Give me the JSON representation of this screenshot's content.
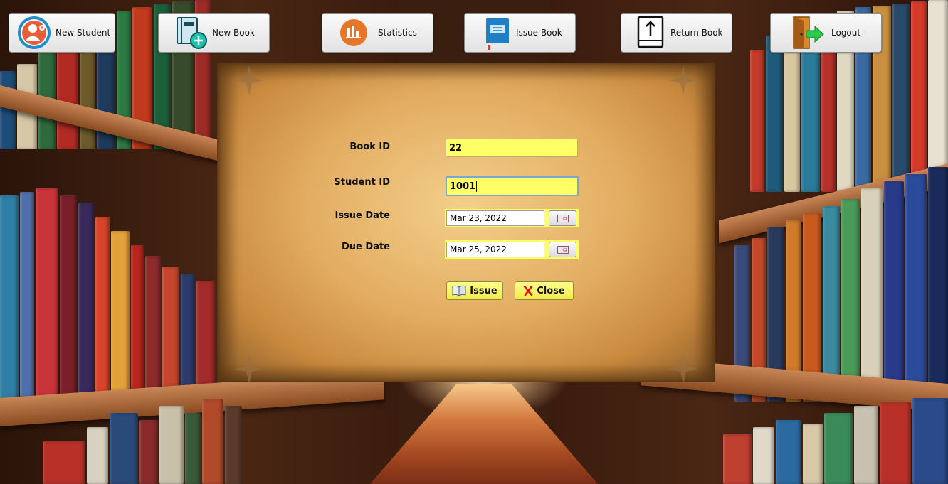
{
  "toolbar": {
    "items": [
      {
        "label": "New Student",
        "icon": "student-avatar-icon"
      },
      {
        "label": "New Book",
        "icon": "new-book-icon"
      },
      {
        "label": "Statistics",
        "icon": "statistics-chart-icon"
      },
      {
        "label": "Issue Book",
        "icon": "issue-book-icon"
      },
      {
        "label": "Return Book",
        "icon": "return-book-icon"
      },
      {
        "label": "Logout",
        "icon": "logout-door-icon"
      }
    ]
  },
  "form": {
    "book_id": {
      "label": "Book ID",
      "value": "22"
    },
    "student_id": {
      "label": "Student ID",
      "value": "1001"
    },
    "issue_date": {
      "label": "Issue Date",
      "value": "Mar 23, 2022"
    },
    "due_date": {
      "label": "Due Date",
      "value": "Mar 25, 2022"
    },
    "issue_button": {
      "label": "Issue",
      "icon": "open-book-icon"
    },
    "close_button": {
      "label": "Close",
      "icon": "close-x-icon"
    }
  },
  "colors": {
    "input_background": "#ffff66",
    "button_background": "#f2ea4a",
    "parchment": "#e3ad62",
    "close_x": "#e01010"
  }
}
